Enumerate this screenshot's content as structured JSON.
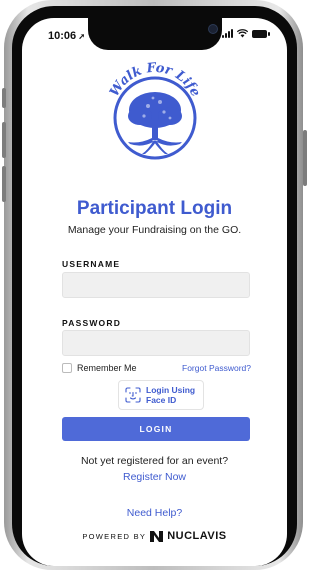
{
  "status": {
    "time": "10:06"
  },
  "logo": {
    "text": "Walk For Life"
  },
  "header": {
    "title": "Participant Login",
    "subtitle": "Manage your Fundraising on the GO."
  },
  "form": {
    "username_label": "USERNAME",
    "username_value": "",
    "password_label": "PASSWORD",
    "password_value": "",
    "remember_label": "Remember Me",
    "forgot_label": "Forgot Password?",
    "faceid_label_line1": "Login Using",
    "faceid_label_line2": "Face ID",
    "login_label": "LOGIN"
  },
  "register": {
    "prompt": "Not yet registered for an event?",
    "link": "Register Now"
  },
  "help_link": "Need Help?",
  "footer": {
    "powered_by": "POWERED BY",
    "brand": "NUCLAVIS"
  },
  "colors": {
    "accent": "#3f5bcf",
    "button": "#4f6ad8"
  }
}
